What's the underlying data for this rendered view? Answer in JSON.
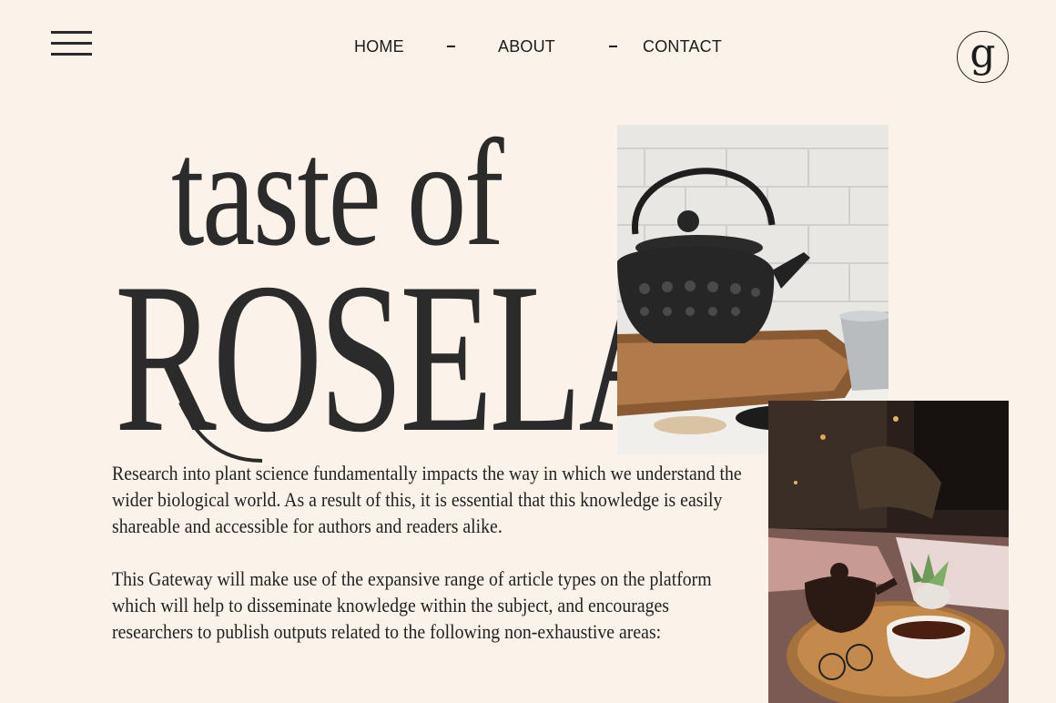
{
  "header": {
    "menu_icon": "hamburger-icon",
    "nav": [
      {
        "label": "HOME"
      },
      {
        "label": "ABOUT"
      },
      {
        "label": "CONTACT"
      }
    ],
    "logo_letter": "g"
  },
  "hero": {
    "title_line1": "taste of",
    "title_line2": "ROSELA"
  },
  "body": {
    "paragraph1": "Research into plant science fundamentally impacts the way in which we understand the wider biological world. As a result of this, it is essential that this knowledge is easily shareable and accessible for authors and readers alike.",
    "paragraph2": "This Gateway will make use of the expansive range of article types on the platform which will help to disseminate knowledge within the subject, and encourages researchers to publish outputs related to the following non-exhaustive areas:"
  },
  "colors": {
    "background": "#fbf2e9",
    "text": "#222222",
    "accent_dark": "#2b2b2b"
  }
}
